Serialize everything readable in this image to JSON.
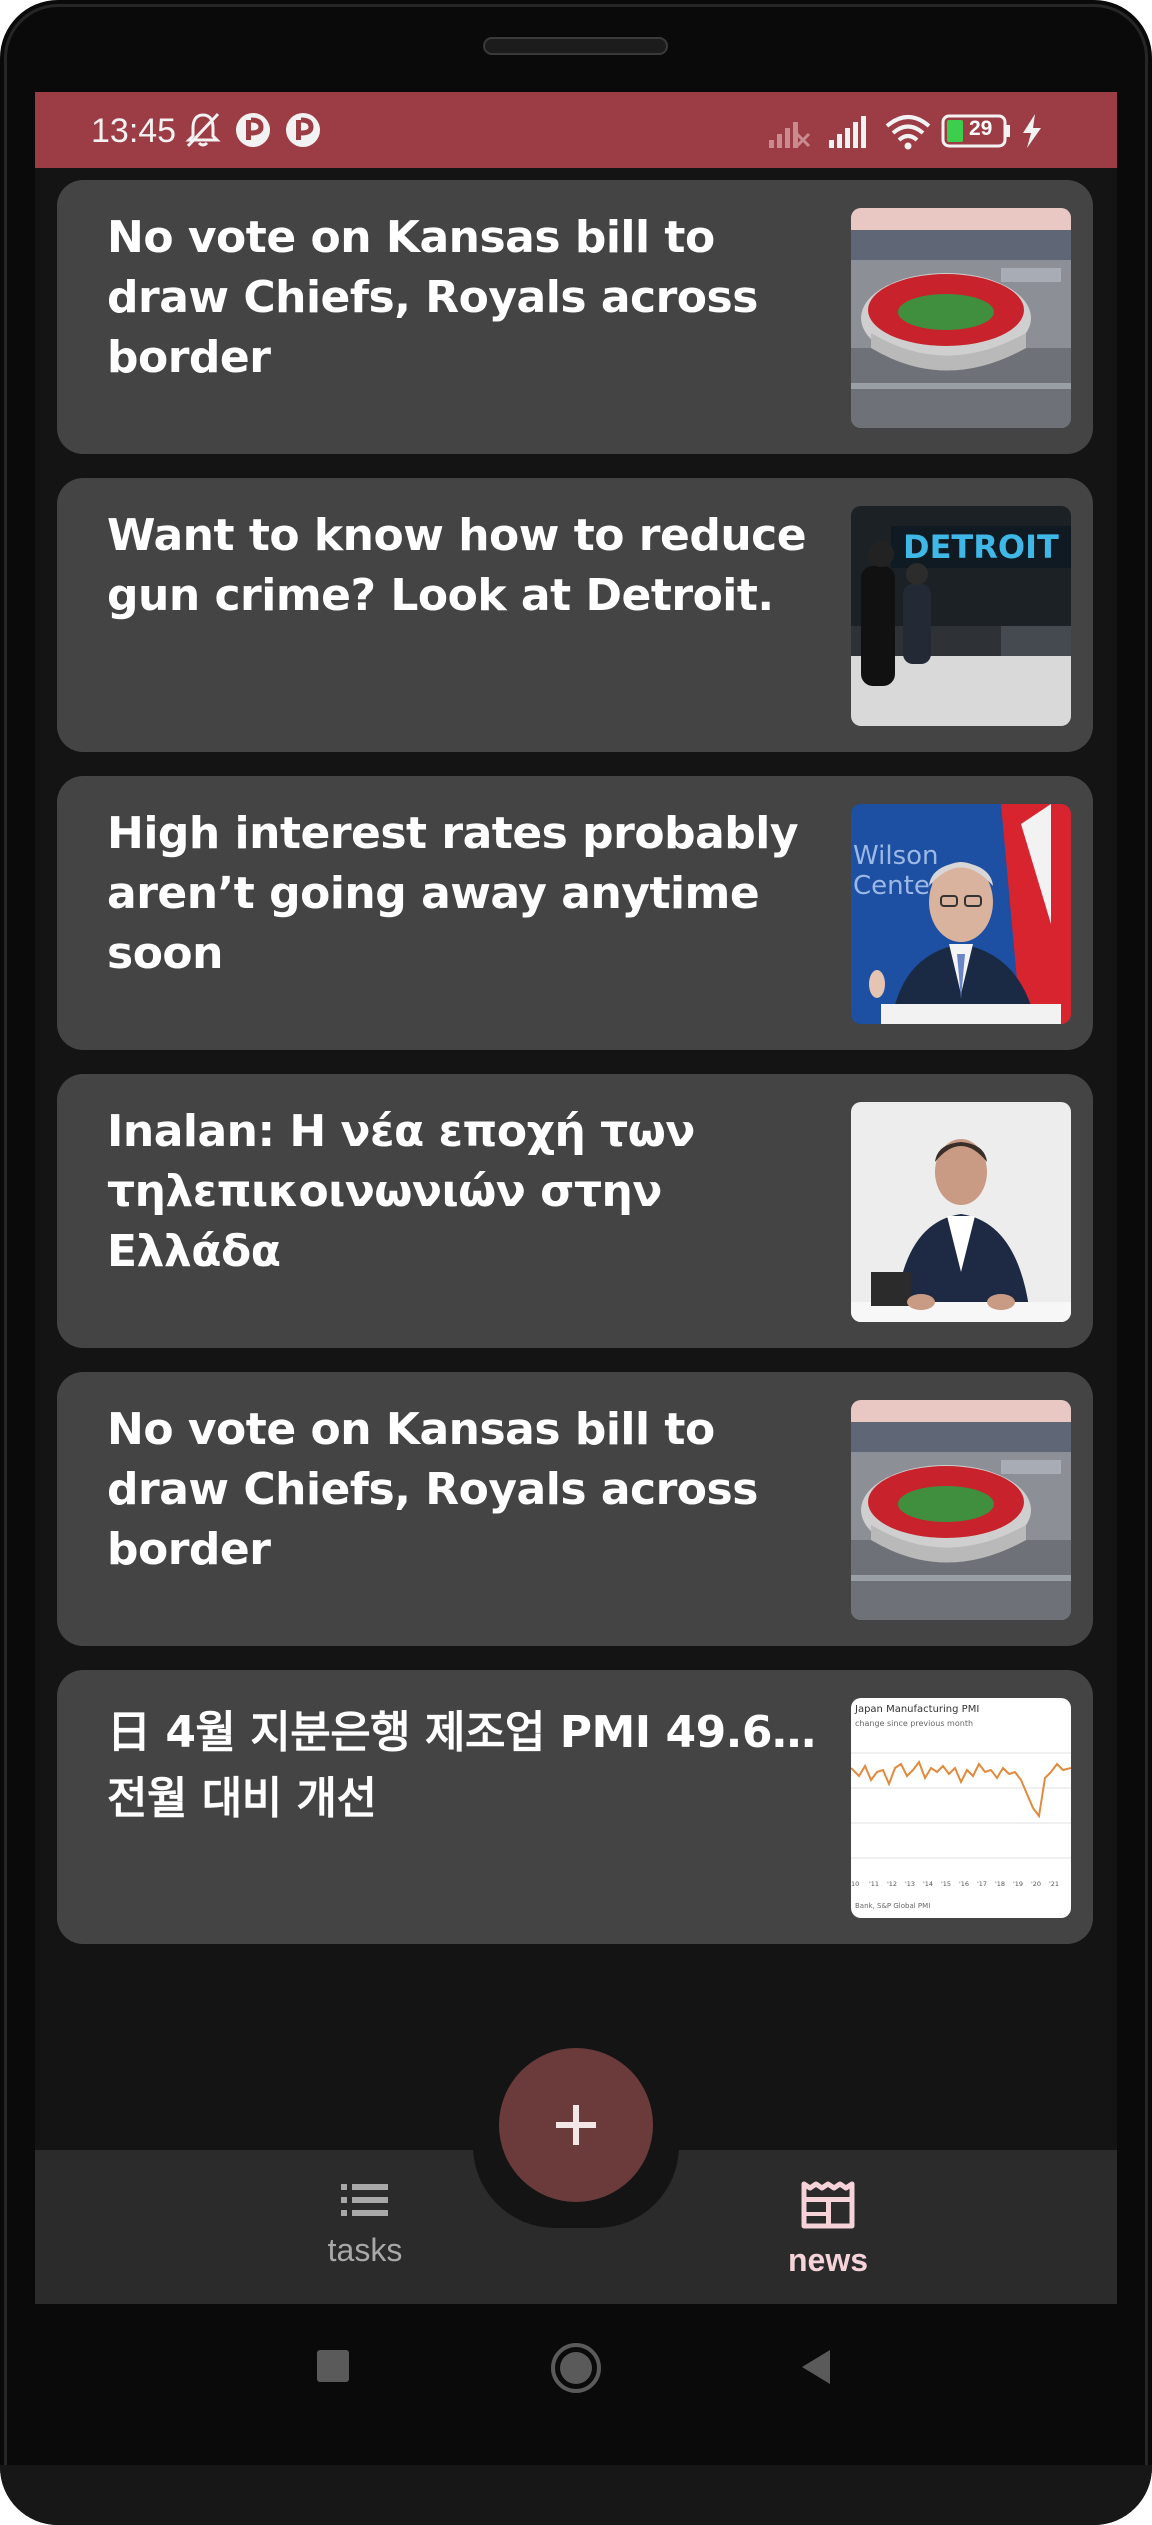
{
  "status_bar": {
    "time": "13:45",
    "battery": "29",
    "icons": [
      "bell-off-icon",
      "app-notification-icon",
      "app-notification-icon",
      "signal-no-service-icon",
      "signal-icon",
      "wifi-icon",
      "battery-icon",
      "charging-icon"
    ],
    "color": "#9c3c45"
  },
  "news": {
    "items": [
      {
        "title": "No vote on Kansas bill to draw Chiefs, Royals across border",
        "thumb": "stadium-aerial-photo"
      },
      {
        "title": "Want to know how to reduce gun crime? Look at Detroit.",
        "thumb": "detroit-street-photo"
      },
      {
        "title": "High interest rates probably aren’t going away anytime soon",
        "thumb": "speaker-at-podium-photo"
      },
      {
        "title": "Inalan: Η νέα εποχή των τηλεπικοινωνιών στην Ελλάδα",
        "thumb": "executive-at-desk-photo"
      },
      {
        "title": "No vote on Kansas bill to draw Chiefs, Royals across border",
        "thumb": "stadium-aerial-photo"
      },
      {
        "title": "日 4월 지분은행 제조업 PMI 49.6…전월 대비 개선",
        "thumb": "pmi-line-chart"
      }
    ]
  },
  "fab": {
    "icon": "plus-icon",
    "color": "#6b3b3c"
  },
  "bottom_nav": {
    "tasks_label": "tasks",
    "news_label": "news",
    "active": "news",
    "active_color": "#f6d3d8"
  },
  "system_nav": {
    "icons": [
      "recents-icon",
      "home-icon",
      "back-icon"
    ]
  },
  "thumb_chart": {
    "title": "Japan Manufacturing PMI",
    "subtitle": "change since previous month",
    "x_ticks": [
      "10",
      "'11",
      "'12",
      "'13",
      "'14",
      "'15",
      "'16",
      "'17",
      "'18",
      "'19",
      "'20",
      "'21"
    ],
    "source": "Bank, S&P Global PMI"
  }
}
